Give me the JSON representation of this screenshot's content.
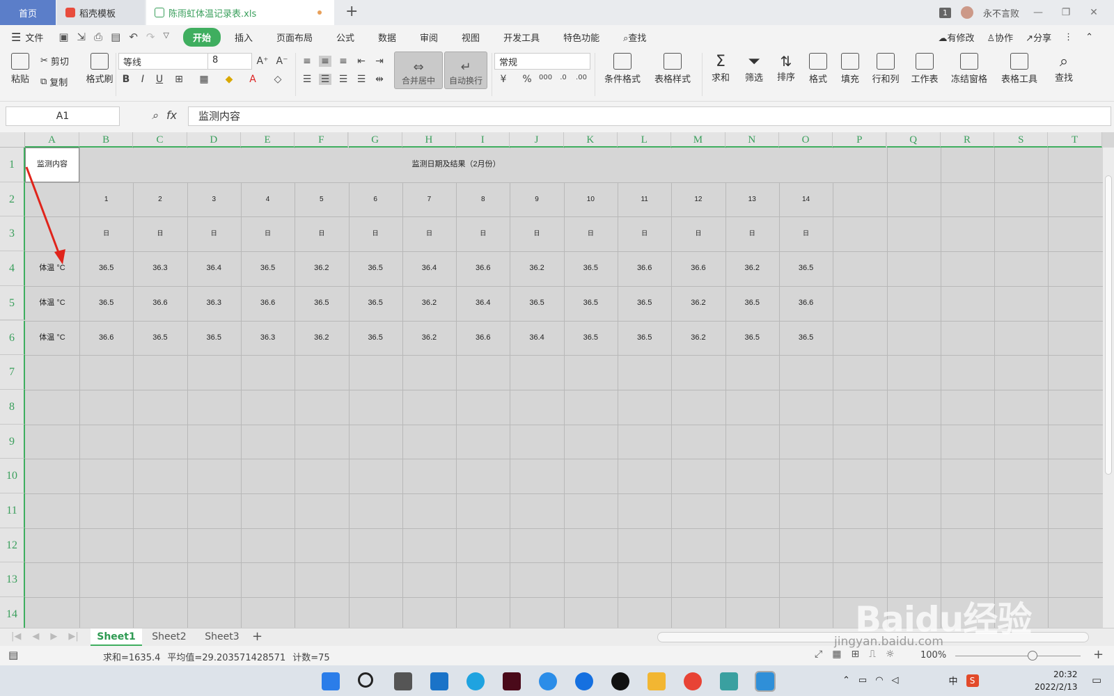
{
  "titlebar": {
    "tabs": [
      {
        "label": "首页"
      },
      {
        "label": "稻壳模板"
      },
      {
        "label": "陈雨虹体温记录表.xls"
      }
    ],
    "new_tab": "+",
    "count_badge": "1",
    "user_name": "永不言败"
  },
  "menubar": {
    "file_label": "文件",
    "items": [
      "开始",
      "插入",
      "页面布局",
      "公式",
      "数据",
      "审阅",
      "视图",
      "开发工具",
      "特色功能",
      "查找"
    ],
    "right": [
      "有修改",
      "协作",
      "分享"
    ]
  },
  "ribbon": {
    "paste": "粘贴",
    "cut": "剪切",
    "copy": "复制",
    "format_painter": "格式刷",
    "font_name": "等线",
    "font_size": "8",
    "merge_center": "合并居中",
    "wrap_text": "自动换行",
    "number_format": "常规",
    "conditional_format": "条件格式",
    "table_style": "表格样式",
    "sum": "求和",
    "filter": "筛选",
    "sort": "排序",
    "format": "格式",
    "fill": "填充",
    "row_col": "行和列",
    "worksheet": "工作表",
    "freeze": "冻结窗格",
    "table_tools": "表格工具",
    "find": "查找"
  },
  "formula_bar": {
    "cell_ref": "A1",
    "fx": "fx",
    "content": "监测内容"
  },
  "sheet": {
    "columns": [
      "A",
      "B",
      "C",
      "D",
      "E",
      "F",
      "G",
      "H",
      "I",
      "J",
      "K",
      "L",
      "M",
      "N",
      "O",
      "P",
      "Q",
      "R",
      "S",
      "T"
    ],
    "rows": [
      "1",
      "2",
      "3",
      "4",
      "5",
      "6",
      "7",
      "8",
      "9",
      "10",
      "11",
      "12",
      "13",
      "14"
    ],
    "a1": "监测内容",
    "header_merged": "监测日期及结果（2月份）",
    "days": [
      "1",
      "2",
      "3",
      "4",
      "5",
      "6",
      "7",
      "8",
      "9",
      "10",
      "11",
      "12",
      "13",
      "14"
    ],
    "day_unit": "日",
    "row_labels": [
      "体温 °C",
      "体温 °C",
      "体温 °C"
    ],
    "values": [
      [
        "36.5",
        "36.3",
        "36.4",
        "36.5",
        "36.2",
        "36.5",
        "36.4",
        "36.6",
        "36.2",
        "36.5",
        "36.6",
        "36.6",
        "36.2",
        "36.5"
      ],
      [
        "36.5",
        "36.6",
        "36.3",
        "36.6",
        "36.5",
        "36.5",
        "36.2",
        "36.4",
        "36.5",
        "36.5",
        "36.5",
        "36.2",
        "36.5",
        "36.6"
      ],
      [
        "36.6",
        "36.5",
        "36.5",
        "36.3",
        "36.2",
        "36.5",
        "36.2",
        "36.6",
        "36.4",
        "36.5",
        "36.5",
        "36.2",
        "36.5",
        "36.5"
      ]
    ]
  },
  "sheet_tabs": [
    "Sheet1",
    "Sheet2",
    "Sheet3"
  ],
  "status": {
    "sum": "求和=1635.4",
    "avg": "平均值=29.203571428571",
    "count": "计数=75",
    "zoom": "100%"
  },
  "taskbar": {
    "ime": "中",
    "time": "20:32",
    "date": "2022/2/13"
  },
  "watermark": {
    "brand": "Baidu经验",
    "url": "jingyan.baidu.com"
  }
}
